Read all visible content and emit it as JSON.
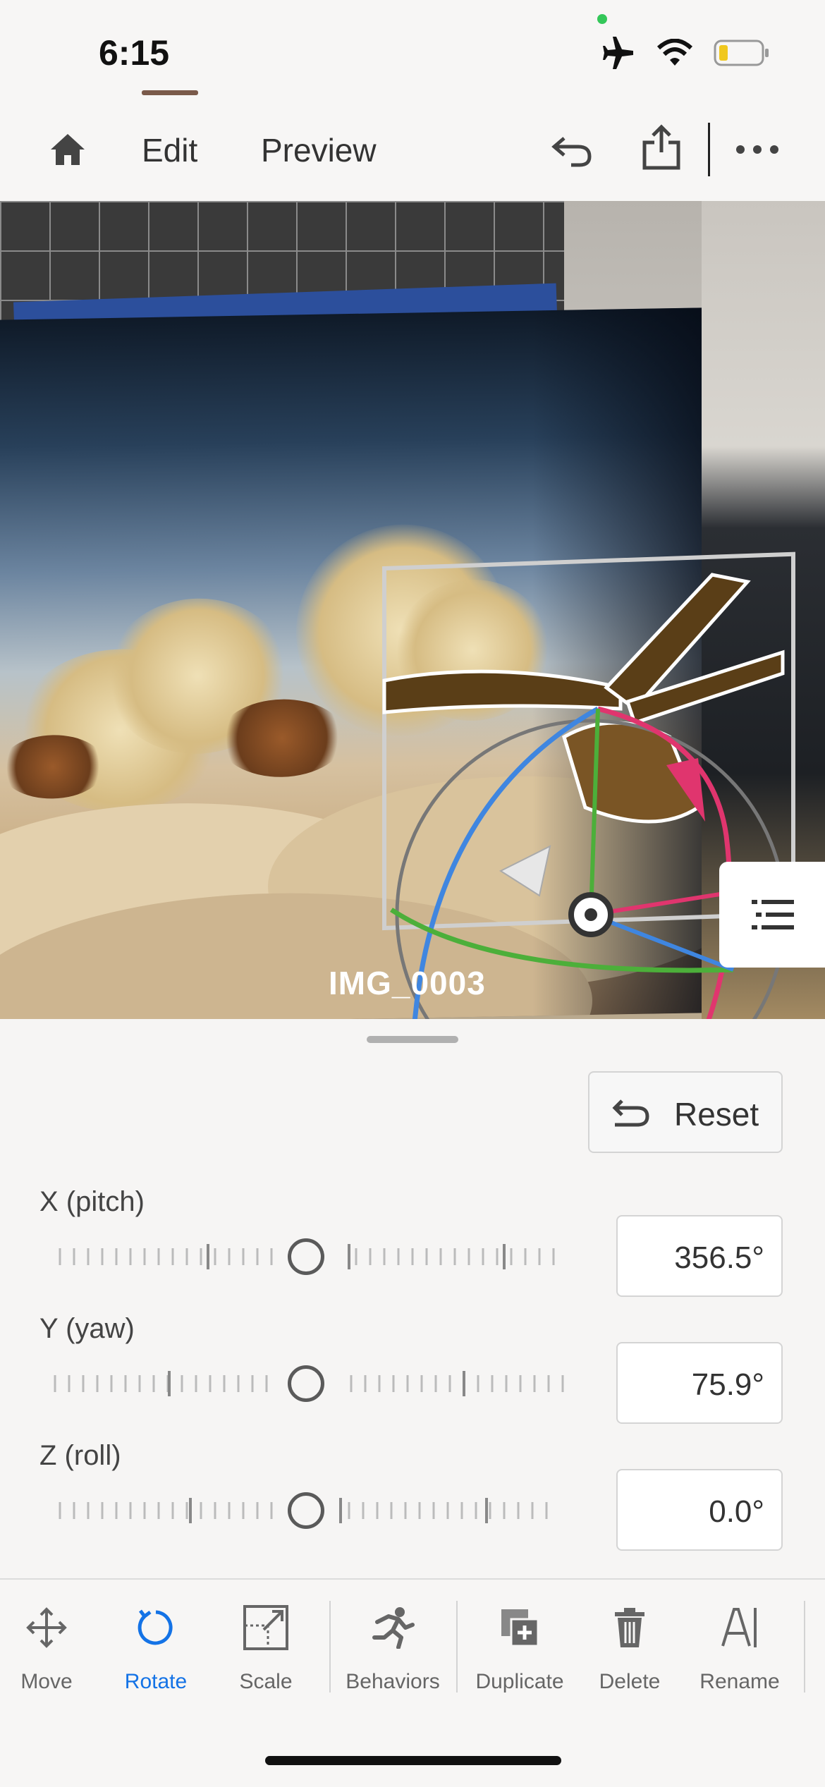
{
  "status_bar": {
    "time": "6:15"
  },
  "header": {
    "tabs": [
      {
        "label": "Edit",
        "active": true
      },
      {
        "label": "Preview",
        "active": false
      }
    ],
    "icons": [
      "home-icon",
      "undo-icon",
      "share-icon",
      "more-icon"
    ]
  },
  "viewport": {
    "object_label": "IMG_0003"
  },
  "rotate_panel": {
    "reset_label": "Reset",
    "axes": [
      {
        "label": "X (pitch)",
        "value": "356.5°"
      },
      {
        "label": "Y (yaw)",
        "value": "75.9°"
      },
      {
        "label": "Z (roll)",
        "value": "0.0°"
      }
    ]
  },
  "toolbar": {
    "items": [
      {
        "label": "Move",
        "icon": "move-icon",
        "active": false
      },
      {
        "label": "Rotate",
        "icon": "rotate-icon",
        "active": true
      },
      {
        "label": "Scale",
        "icon": "scale-icon",
        "active": false
      },
      {
        "label": "Behaviors",
        "icon": "behaviors-icon",
        "active": false
      },
      {
        "label": "Duplicate",
        "icon": "duplicate-icon",
        "active": false
      },
      {
        "label": "Delete",
        "icon": "delete-icon",
        "active": false
      },
      {
        "label": "Rename",
        "icon": "rename-icon",
        "active": false
      }
    ]
  },
  "colors": {
    "accent": "#1473e6",
    "x_axis": "#e0356e",
    "y_axis": "#4caf3a",
    "z_axis": "#3f86e0"
  }
}
